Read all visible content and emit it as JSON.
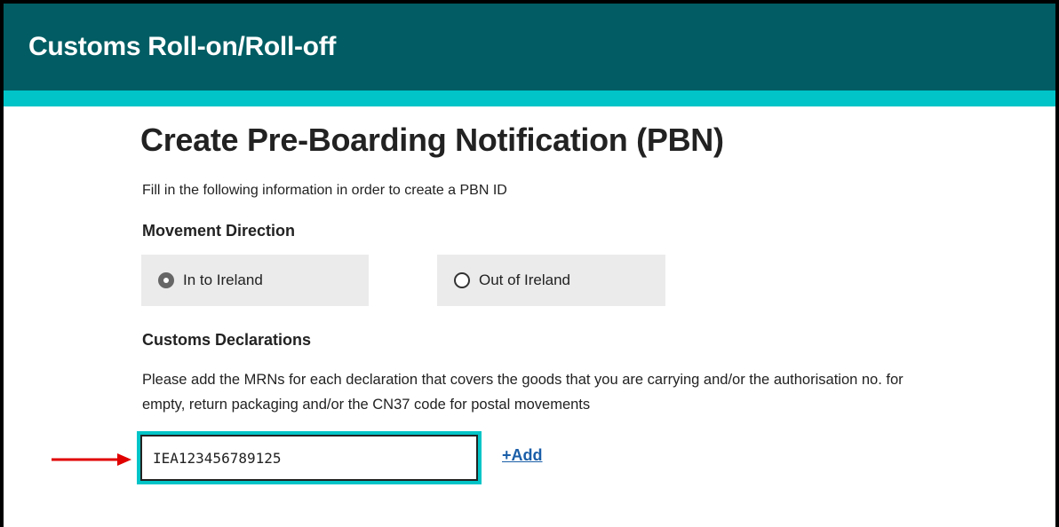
{
  "header": {
    "title": "Customs Roll-on/Roll-off"
  },
  "page": {
    "title": "Create Pre-Boarding Notification (PBN)",
    "intro": "Fill in the following information in order to create a PBN ID"
  },
  "movement_direction": {
    "label": "Movement Direction",
    "options": [
      {
        "label": "In to Ireland",
        "selected": true
      },
      {
        "label": "Out of Ireland",
        "selected": false
      }
    ]
  },
  "customs_declarations": {
    "label": "Customs Declarations",
    "help_text": "Please add the MRNs for each declaration that covers the goods that you are carrying and/or the authorisation no. for empty, return packaging and/or the CN37 code for postal movements",
    "mrn_input_value": "IEA123456789125",
    "add_label": "+Add"
  },
  "annotation": {
    "arrow_icon": "right-arrow-icon",
    "arrow_color": "#e00000"
  },
  "colors": {
    "header_bg": "#015d63",
    "accent": "#00c4c7",
    "link": "#1a5ea8"
  }
}
